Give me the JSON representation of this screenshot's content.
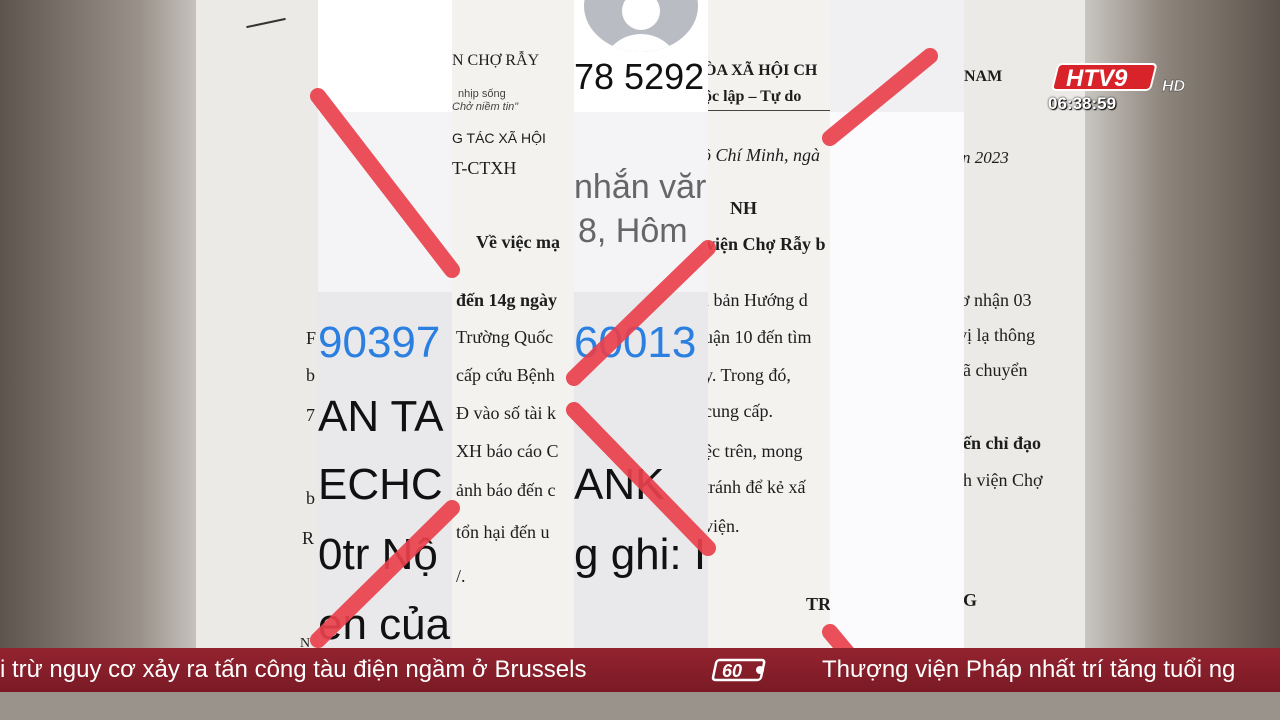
{
  "doc": {
    "org1": "N CHỢ RẪY",
    "slogan1": "nhịp sống",
    "slogan2": "Chở niềm tin\"",
    "dept": "G TÁC XÃ HỘI",
    "code": "T-CTXH",
    "subject": "Về việc mạ",
    "line1": "đến 14g ngày",
    "line2": "Trường Quốc",
    "line3": "cấp cứu Bệnh",
    "line4": "Đ vào số tài k",
    "line5": "XH báo cáo C",
    "line6": "ảnh báo đến c",
    "line7": "tổn hại đến u",
    "line8": "/.",
    "frag_b1": "F",
    "frag_b2": "b",
    "frag_b3": "7",
    "frag_b4": "b",
    "frag_b5": "R",
    "frag_b6": "N",
    "nation_a": "ÒA XÃ HỘI CH",
    "nation_b": "ộc lập – Tự do",
    "place": "ồ Chí Minh, ngà",
    "title2": "NH",
    "subject2": "viện Chợ Rẫy b",
    "p1": "i bản Hướng d",
    "p2": "uận 10 đến tìm",
    "p3": "y. Trong đó,",
    "p4": "cung cấp.",
    "p5": "ệc trên, mong",
    "p6": "tránh để kẻ xấ",
    "p7": "viện.",
    "nam": "NAM",
    "year": "n 2023",
    "r1": "ơ nhận 03",
    "r2": "vị lạ thông",
    "r3": "đã chuyển",
    "r4": "iến chỉ đạo",
    "r5": "nh viện Chợ",
    "sign1": "TR",
    "sign2": "NG"
  },
  "phone": {
    "number": "78 5292",
    "msg1": "nhắn văr",
    "msg2": "8, Hôm",
    "acct_a": "90397",
    "acct_b": "60013",
    "l1": "AN TA",
    "l2": "ECHC",
    "l3": "0tr Nộ",
    "l4": "en của",
    "l5": "ANK",
    "l6": "g ghi: I"
  },
  "overlay": {
    "channel": "HTV9",
    "channel_suffix": "HD",
    "time": "06:38:59"
  },
  "ticker": {
    "headline_left": "i trừ nguy cơ xảy ra tấn công tàu điện ngầm ở Brussels",
    "headline_right": "Thượng viện Pháp nhất trí tăng tuổi ng",
    "logo_text": "60"
  },
  "colors": {
    "ticker_bg": "#8a1f2b",
    "cross_red": "#e8404c",
    "link_blue": "#2a7fe0"
  }
}
